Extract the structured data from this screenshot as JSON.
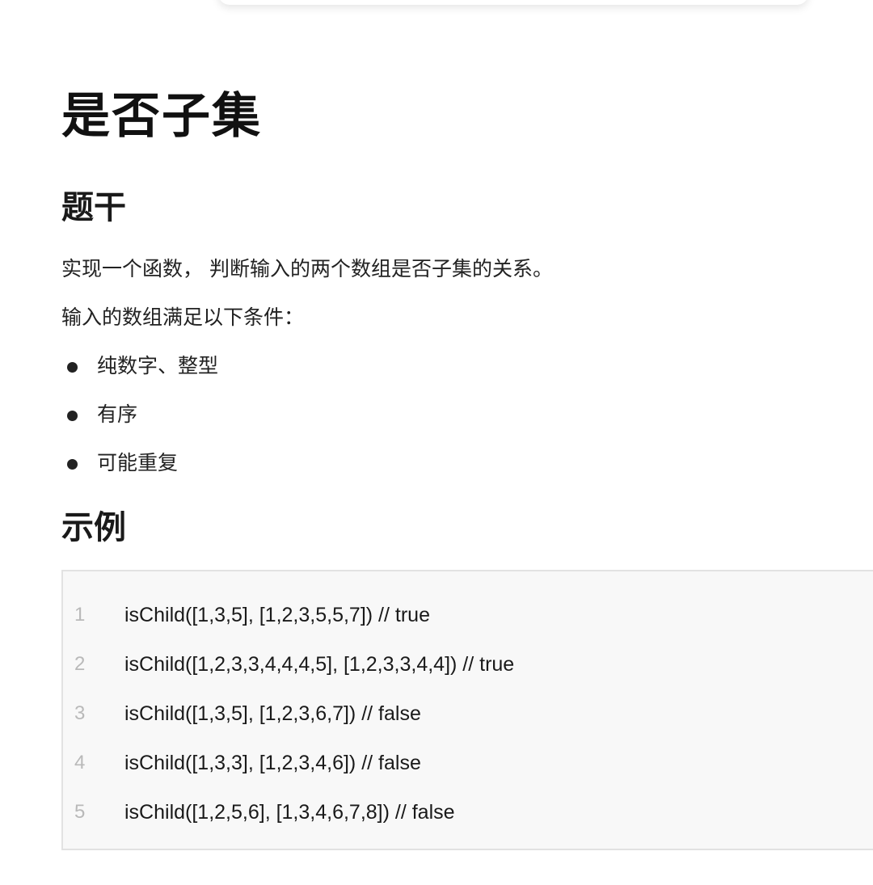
{
  "title": "是否子集",
  "sections": {
    "stem": {
      "heading": "题干",
      "paragraphs": [
        "实现一个函数， 判断输入的两个数组是否子集的关系。",
        "输入的数组满足以下条件："
      ],
      "bullets": [
        "纯数字、整型",
        "有序",
        "可能重复"
      ]
    },
    "example": {
      "heading": "示例",
      "code": [
        {
          "no": "1",
          "text": "isChild([1,3,5], [1,2,3,5,5,7]) // true"
        },
        {
          "no": "2",
          "text": "isChild([1,2,3,3,4,4,4,5], [1,2,3,3,4,4]) // true"
        },
        {
          "no": "3",
          "text": "isChild([1,3,5], [1,2,3,6,7]) // false"
        },
        {
          "no": "4",
          "text": "isChild([1,3,3], [1,2,3,4,6]) // false"
        },
        {
          "no": "5",
          "text": "isChild([1,2,5,6], [1,3,4,6,7,8]) // false"
        }
      ]
    }
  },
  "colors": {
    "code_background": "#f8f8f8",
    "code_border": "#e2e2e2",
    "line_number": "#b9b9b9"
  }
}
